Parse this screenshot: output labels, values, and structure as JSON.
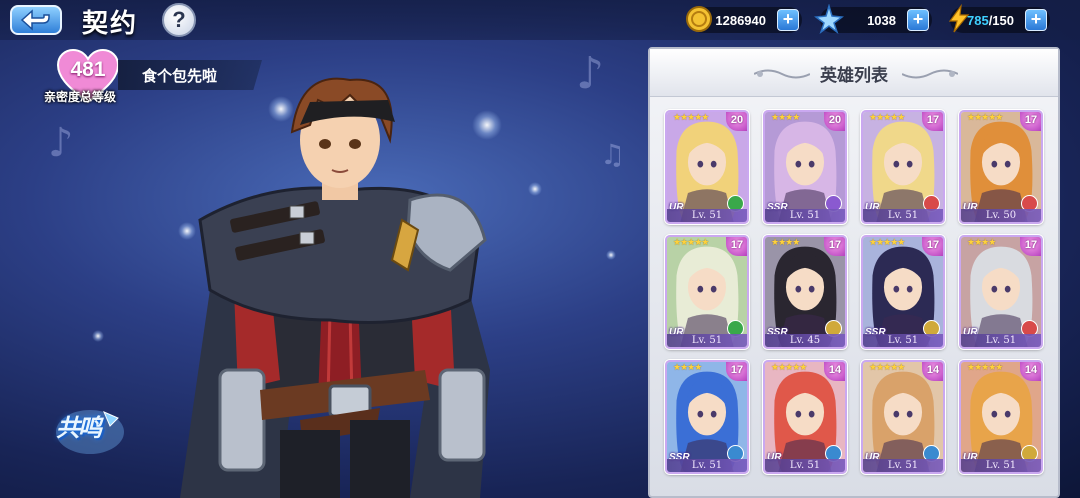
{
  "header": {
    "title": "契约",
    "help_label": "?",
    "resources": [
      {
        "name": "gold",
        "icon": "gold-coin-icon",
        "value": "1286940"
      },
      {
        "name": "crystal",
        "icon": "blue-star-crystal-icon",
        "value": "1038"
      },
      {
        "name": "stamina",
        "icon": "lightning-bolt-icon",
        "current": "785",
        "max": "/150"
      }
    ],
    "plus_label": "+"
  },
  "affinity": {
    "level": "481",
    "label": "亲密度总等级",
    "character_name": "食个包先啦"
  },
  "resonance": {
    "label": "共鸣"
  },
  "hero_list": {
    "title": "英雄列表",
    "heroes": [
      {
        "stars": "★★★★★",
        "badge": "20",
        "rarity": "UR",
        "level": "Lv. 51",
        "class_color": "#3aa84a",
        "hair": "#f1d27a",
        "bg": "#c9a8e8"
      },
      {
        "stars": "★★★★",
        "badge": "20",
        "rarity": "SSR",
        "level": "Lv. 51",
        "class_color": "#8a5ad0",
        "hair": "#d7b6e6",
        "bg": "#b59ad6"
      },
      {
        "stars": "★★★★★",
        "badge": "17",
        "rarity": "UR",
        "level": "Lv. 51",
        "class_color": "#d84a4a",
        "hair": "#f0d88a",
        "bg": "#c7b2e2"
      },
      {
        "stars": "★★★★★",
        "badge": "17",
        "rarity": "UR",
        "level": "Lv. 50",
        "class_color": "#d84a4a",
        "hair": "#e08f3a",
        "bg": "#d9b89a"
      },
      {
        "stars": "★★★★★",
        "badge": "17",
        "rarity": "UR",
        "level": "Lv. 51",
        "class_color": "#3aa84a",
        "hair": "#e8ecd6",
        "bg": "#b8d2a6"
      },
      {
        "stars": "★★★★",
        "badge": "17",
        "rarity": "SSR",
        "level": "Lv. 45",
        "class_color": "#d0a93a",
        "hair": "#2a2630",
        "bg": "#9a94a8"
      },
      {
        "stars": "★★★★★",
        "badge": "17",
        "rarity": "SSR",
        "level": "Lv. 51",
        "class_color": "#d0a93a",
        "hair": "#2c2a54",
        "bg": "#a9b3dc"
      },
      {
        "stars": "★★★★",
        "badge": "17",
        "rarity": "UR",
        "level": "Lv. 51",
        "class_color": "#d84a4a",
        "hair": "#d9dbe0",
        "bg": "#c7a3a3"
      },
      {
        "stars": "★★★★",
        "badge": "17",
        "rarity": "SSR",
        "level": "Lv. 51",
        "class_color": "#3a8ad0",
        "hair": "#3b6fd6",
        "bg": "#8fb6e8"
      },
      {
        "stars": "★★★★★",
        "badge": "14",
        "rarity": "UR",
        "level": "Lv. 51",
        "class_color": "#3a8ad0",
        "hair": "#e0584a",
        "bg": "#e8b6c2"
      },
      {
        "stars": "★★★★★",
        "badge": "14",
        "rarity": "UR",
        "level": "Lv. 51",
        "class_color": "#3a8ad0",
        "hair": "#d9a26a",
        "bg": "#e2c6a8"
      },
      {
        "stars": "★★★★★",
        "badge": "14",
        "rarity": "UR",
        "level": "Lv. 51",
        "class_color": "#d0a93a",
        "hair": "#e8a44a",
        "bg": "#e0a68a"
      }
    ]
  }
}
